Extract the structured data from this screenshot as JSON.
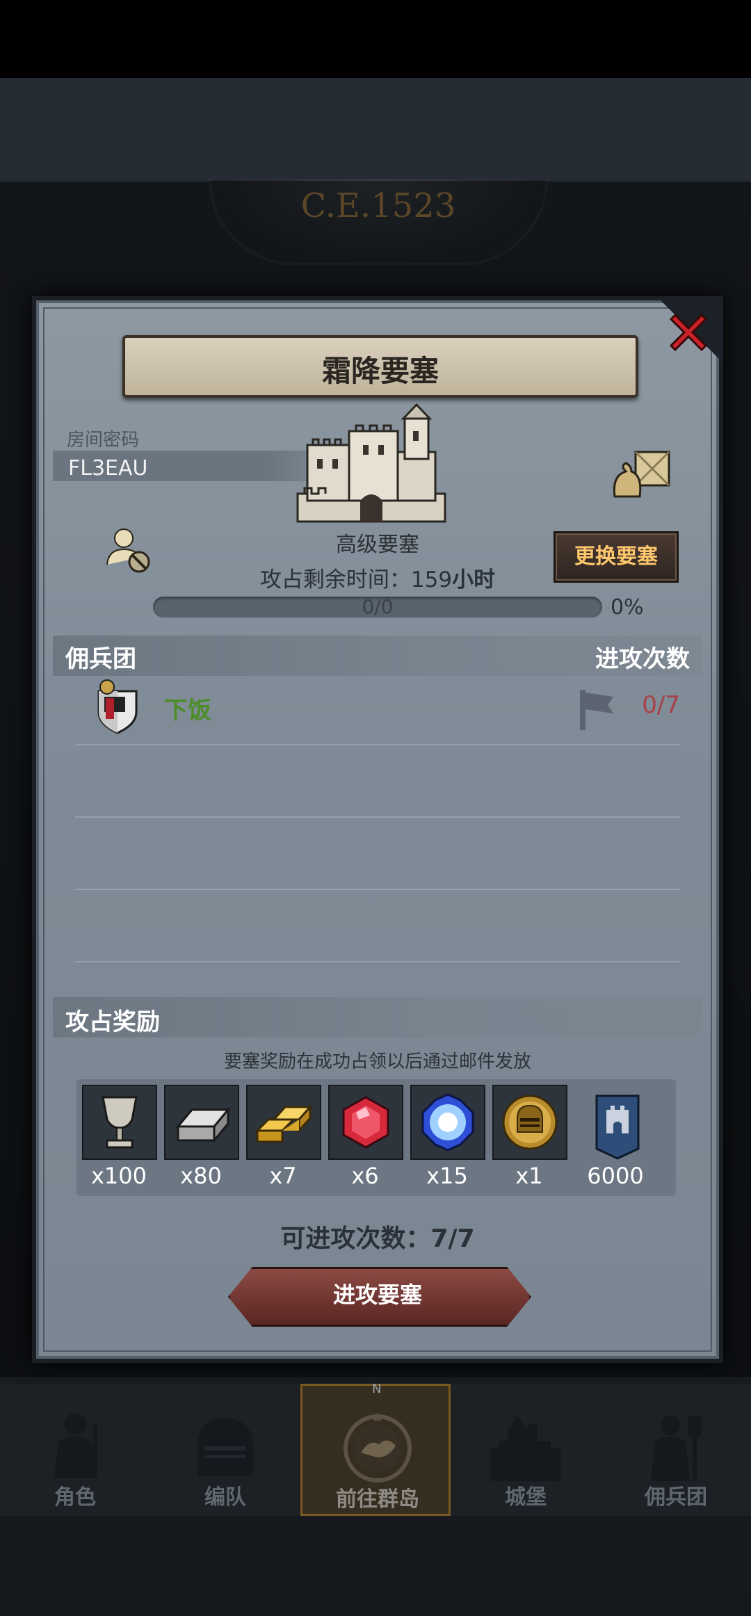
{
  "header": {
    "era_label": "C.E.1523"
  },
  "dialog": {
    "title": "霜降要塞",
    "room_code_label": "房间密码",
    "room_code": "FL3EAU",
    "fortress_level": "高级要塞",
    "change_button": "更换要塞",
    "time_label": "攻占剩余时间：",
    "time_value": "159",
    "time_unit": "小时",
    "progress": {
      "text": "0/0",
      "percent_label": "0%",
      "fraction": 0
    },
    "mercenary_section": {
      "left_label": "佣兵团",
      "right_label": "进攻次数",
      "rows": [
        {
          "name": "下饭",
          "count": "0/7"
        }
      ]
    },
    "reward_section": {
      "label": "攻占奖励",
      "note": "要塞奖励在成功占领以后通过邮件发放",
      "items": [
        {
          "icon": "goblet-icon",
          "qty": "x100"
        },
        {
          "icon": "iron-ingot-icon",
          "qty": "x80"
        },
        {
          "icon": "gold-bars-icon",
          "qty": "x7"
        },
        {
          "icon": "ruby-icon",
          "qty": "x6"
        },
        {
          "icon": "crystal-icon",
          "qty": "x15"
        },
        {
          "icon": "knight-helmet-coin-icon",
          "qty": "x1"
        },
        {
          "icon": "castle-banner-icon",
          "qty": "6000"
        }
      ]
    },
    "attack_count": "可进攻次数：7/7",
    "attack_button": "进攻要塞"
  },
  "bottom_nav": {
    "items": [
      {
        "label": "角色",
        "icon": "knight-icon"
      },
      {
        "label": "编队",
        "icon": "helmet-icon"
      },
      {
        "label": "前往群岛",
        "icon": "compass-icon",
        "active": true
      },
      {
        "label": "城堡",
        "icon": "castle-icon"
      },
      {
        "label": "佣兵团",
        "icon": "warrior-icon"
      }
    ],
    "compass_letter": "N"
  },
  "colors": {
    "accent_gold": "#ffc76d",
    "merc_name_green": "#4d8d2a",
    "count_red": "#a8404a",
    "close_red": "#c8232a"
  }
}
